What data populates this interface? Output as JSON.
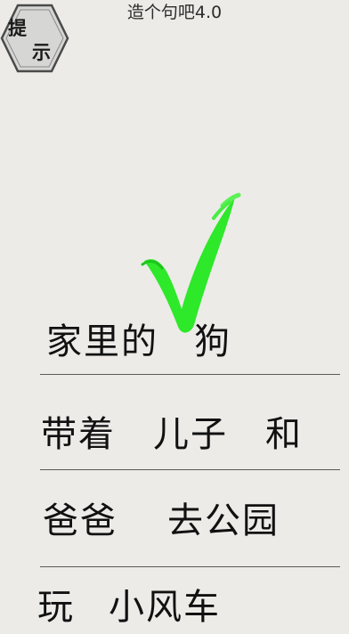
{
  "title": "造个句吧4.0",
  "hint_button": {
    "chars": [
      "提",
      "示"
    ],
    "icon": "hexagon-hint-icon"
  },
  "feedback": {
    "icon": "checkmark-icon",
    "color": "#2ee82a"
  },
  "rows": [
    {
      "words": [
        "家里的",
        "狗"
      ]
    },
    {
      "words": [
        "带着",
        "儿子",
        "和"
      ]
    },
    {
      "words": [
        "爸爸",
        "去公园"
      ]
    },
    {
      "words": [
        "玩",
        "小风车"
      ]
    }
  ]
}
